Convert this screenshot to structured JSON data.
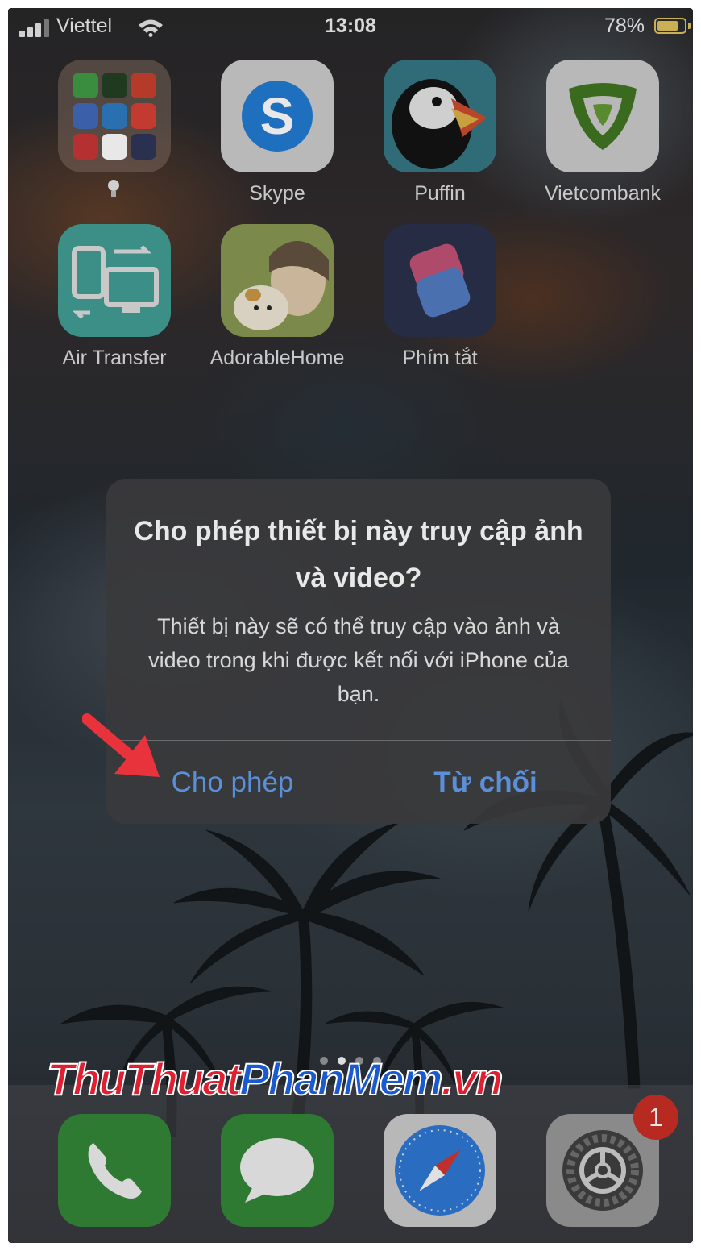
{
  "status_bar": {
    "carrier": "Viettel",
    "time": "13:08",
    "battery_percent": "78%",
    "battery_level": 0.78
  },
  "apps": [
    {
      "label": "",
      "icon": "folder-icon"
    },
    {
      "label": "Skype",
      "icon": "skype-icon"
    },
    {
      "label": "Puffin",
      "icon": "puffin-icon"
    },
    {
      "label": "Vietcombank",
      "icon": "vietcombank-icon"
    },
    {
      "label": "Air Transfer",
      "icon": "air-transfer-icon"
    },
    {
      "label": "AdorableHome",
      "icon": "adorable-home-icon"
    },
    {
      "label": "Phím tắt",
      "icon": "shortcuts-icon"
    }
  ],
  "dialog": {
    "title": "Cho phép thiết bị này truy cập ảnh và video?",
    "message": "Thiết bị này sẽ có thể truy cập vào ảnh và video trong khi được kết nối với iPhone của bạn.",
    "allow_label": "Cho phép",
    "deny_label": "Từ chối"
  },
  "watermark": {
    "part1": "ThuThuat",
    "part2": "PhanMem",
    "part3": ".vn"
  },
  "dock": {
    "apps": [
      "phone-icon",
      "messages-icon",
      "safari-icon",
      "settings-icon"
    ],
    "settings_badge": "1"
  },
  "colors": {
    "dialog_button": "#5b8fd8",
    "annotation_arrow": "#e8323c",
    "badge": "#b72a22"
  }
}
